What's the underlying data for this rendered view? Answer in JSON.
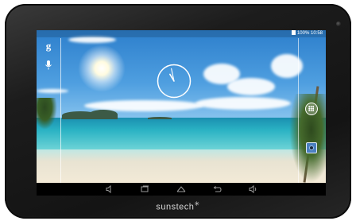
{
  "device": {
    "brand": "sunstech",
    "spark": "✳",
    "bezel_color": "#1a1a1a"
  },
  "status_bar": {
    "battery": "100%",
    "time": "10:58"
  },
  "home_screen": {
    "search_icon": "google-g-icon",
    "search_glyph": "g",
    "voice_icon": "mic-icon",
    "widget": "analog-clock-widget",
    "clock": {
      "hour": 10,
      "minute": 58
    },
    "apps_button": "apps-drawer-icon",
    "dock_app": "camera-icon"
  },
  "navigation_bar": [
    {
      "name": "volume-down-icon"
    },
    {
      "name": "recent-apps-icon"
    },
    {
      "name": "home-icon"
    },
    {
      "name": "back-icon"
    },
    {
      "name": "volume-up-icon"
    }
  ],
  "colors": {
    "sky": "#4f9fe0",
    "sea": "#2bb3c4",
    "sand": "#f3ead7",
    "camera_app": "#4a7fc0"
  }
}
